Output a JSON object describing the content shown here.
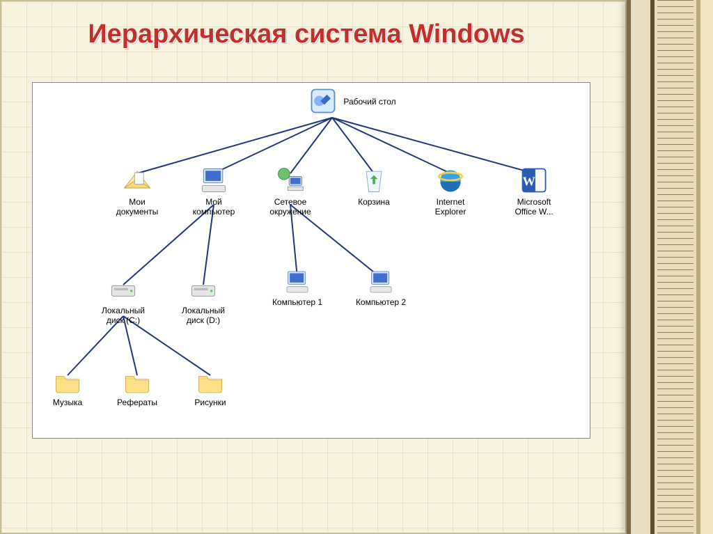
{
  "title": "Иерархическая система Windows",
  "nodes": {
    "desktop": {
      "label": "Рабочий стол"
    },
    "mydocs": {
      "label": "Мои\nдокументы"
    },
    "mycomputer": {
      "label": "Мой\nкомпьютер"
    },
    "network": {
      "label": "Сетевое\nокружение"
    },
    "recycle": {
      "label": "Корзина"
    },
    "ie": {
      "label": "Internet\nExplorer"
    },
    "word": {
      "label": "Microsoft\nOffice W..."
    },
    "diskc": {
      "label": "Локальный\nдиск (C:)"
    },
    "diskd": {
      "label": "Локальный\nдиск (D:)"
    },
    "pc1": {
      "label": "Компьютер 1"
    },
    "pc2": {
      "label": "Компьютер 2"
    },
    "music": {
      "label": "Музыка"
    },
    "essays": {
      "label": "Рефераты"
    },
    "pictures": {
      "label": "Рисунки"
    }
  },
  "edges": [
    [
      "desktop",
      "mydocs"
    ],
    [
      "desktop",
      "mycomputer"
    ],
    [
      "desktop",
      "network"
    ],
    [
      "desktop",
      "recycle"
    ],
    [
      "desktop",
      "ie"
    ],
    [
      "desktop",
      "word"
    ],
    [
      "mycomputer",
      "diskc"
    ],
    [
      "mycomputer",
      "diskd"
    ],
    [
      "network",
      "pc1"
    ],
    [
      "network",
      "pc2"
    ],
    [
      "diskc",
      "music"
    ],
    [
      "diskc",
      "essays"
    ],
    [
      "diskc",
      "pictures"
    ]
  ],
  "colors": {
    "line": "#22377e",
    "title": "#c1302b"
  }
}
